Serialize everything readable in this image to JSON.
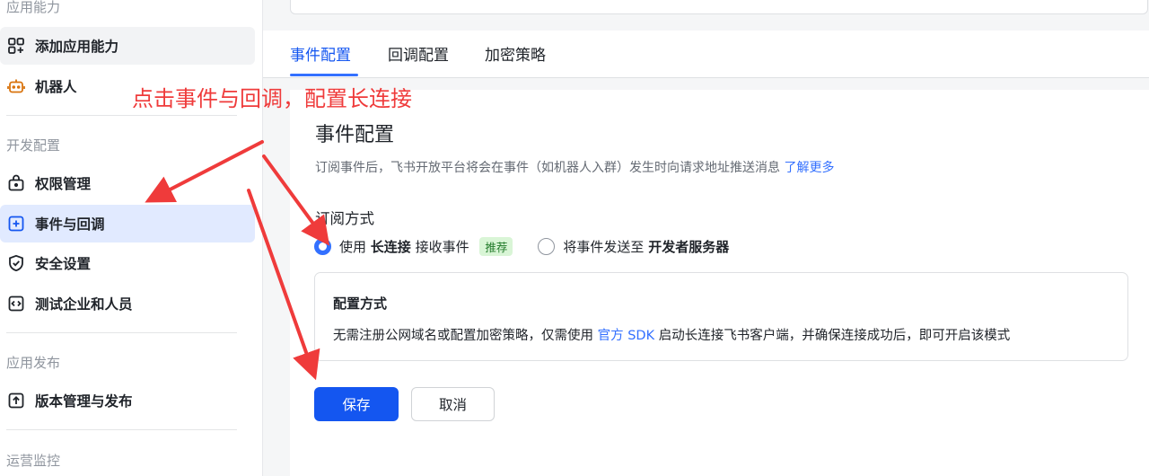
{
  "sidebar": {
    "sections": [
      {
        "title": "应用能力"
      },
      {
        "title": "开发配置"
      },
      {
        "title": "应用发布"
      },
      {
        "title": "运营监控"
      }
    ],
    "items": [
      {
        "label": "添加应用能力",
        "icon": "grid-add-icon"
      },
      {
        "label": "机器人",
        "icon": "robot-icon"
      },
      {
        "label": "权限管理",
        "icon": "lock-icon"
      },
      {
        "label": "事件与回调",
        "icon": "event-plus-icon"
      },
      {
        "label": "安全设置",
        "icon": "shield-check-icon"
      },
      {
        "label": "测试企业和人员",
        "icon": "code-icon"
      },
      {
        "label": "版本管理与发布",
        "icon": "upload-icon"
      }
    ]
  },
  "tabs": [
    {
      "label": "事件配置"
    },
    {
      "label": "回调配置"
    },
    {
      "label": "加密策略"
    }
  ],
  "panel": {
    "title": "事件配置",
    "desc": "订阅事件后，飞书开放平台将会在事件（如机器人入群）发生时向请求地址推送消息",
    "desc_link": "了解更多",
    "subscribe_label": "订阅方式",
    "option1": {
      "prefix": "使用",
      "strong": "长连接",
      "suffix": "接收事件",
      "badge": "推荐"
    },
    "option2": {
      "prefix": "将事件发送至",
      "strong": "开发者服务器"
    },
    "config_box": {
      "title": "配置方式",
      "text_before": "无需注册公网域名或配置加密策略，仅需使用 ",
      "link": "官方 SDK",
      "text_after": " 启动长连接飞书客户端，并确保连接成功后，即可开启该模式"
    },
    "save_label": "保存",
    "cancel_label": "取消"
  },
  "annotation": {
    "text": "点击事件与回调，配置长连接",
    "color": "#ef3b3b"
  },
  "colors": {
    "accent": "#3370ff",
    "primary_button": "#1456f0",
    "active_nav_bg": "#e1eaff"
  }
}
